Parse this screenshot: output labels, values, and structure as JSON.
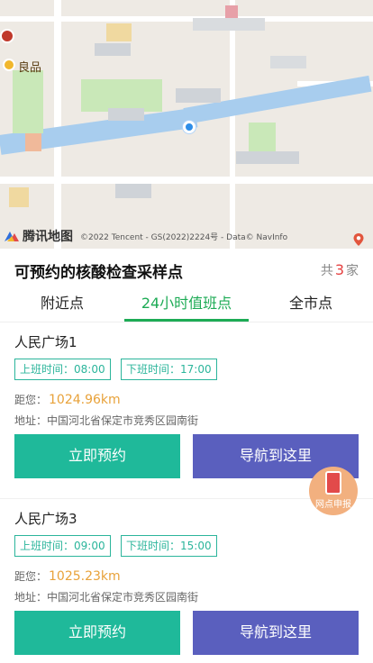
{
  "map": {
    "poi_label": "良品",
    "brand": "腾讯地图",
    "copyright": "©2022 Tencent - GS(2022)2224号 - Data© NavInfo"
  },
  "header": {
    "title": "可预约的核酸检查采样点",
    "count_prefix": "共",
    "count_value": "3",
    "count_suffix": "家"
  },
  "tabs": [
    {
      "label": "附近点",
      "active": false
    },
    {
      "label": "24小时值班点",
      "active": true
    },
    {
      "label": "全市点",
      "active": false
    }
  ],
  "sites": [
    {
      "name": "人民广场1",
      "start_label": "上班时间：",
      "start_time": "08:00",
      "end_label": "下班时间：",
      "end_time": "17:00",
      "distance_label": "距您：",
      "distance": "1024.96km",
      "address_label": "地址：",
      "address": "中国河北省保定市竞秀区园南街",
      "book_label": "立即预约",
      "nav_label": "导航到这里"
    },
    {
      "name": "人民广场3",
      "start_label": "上班时间：",
      "start_time": "09:00",
      "end_label": "下班时间：",
      "end_time": "15:00",
      "distance_label": "距您：",
      "distance": "1025.23km",
      "address_label": "地址：",
      "address": "中国河北省保定市竞秀区园南街",
      "book_label": "立即预约",
      "nav_label": "导航到这里"
    }
  ],
  "float": {
    "label": "网点申报"
  },
  "colors": {
    "accent_green": "#1dab55",
    "book_button": "#1fb99a",
    "nav_button": "#5a5fbe",
    "distance": "#e8a23a",
    "count": "#e54141"
  }
}
